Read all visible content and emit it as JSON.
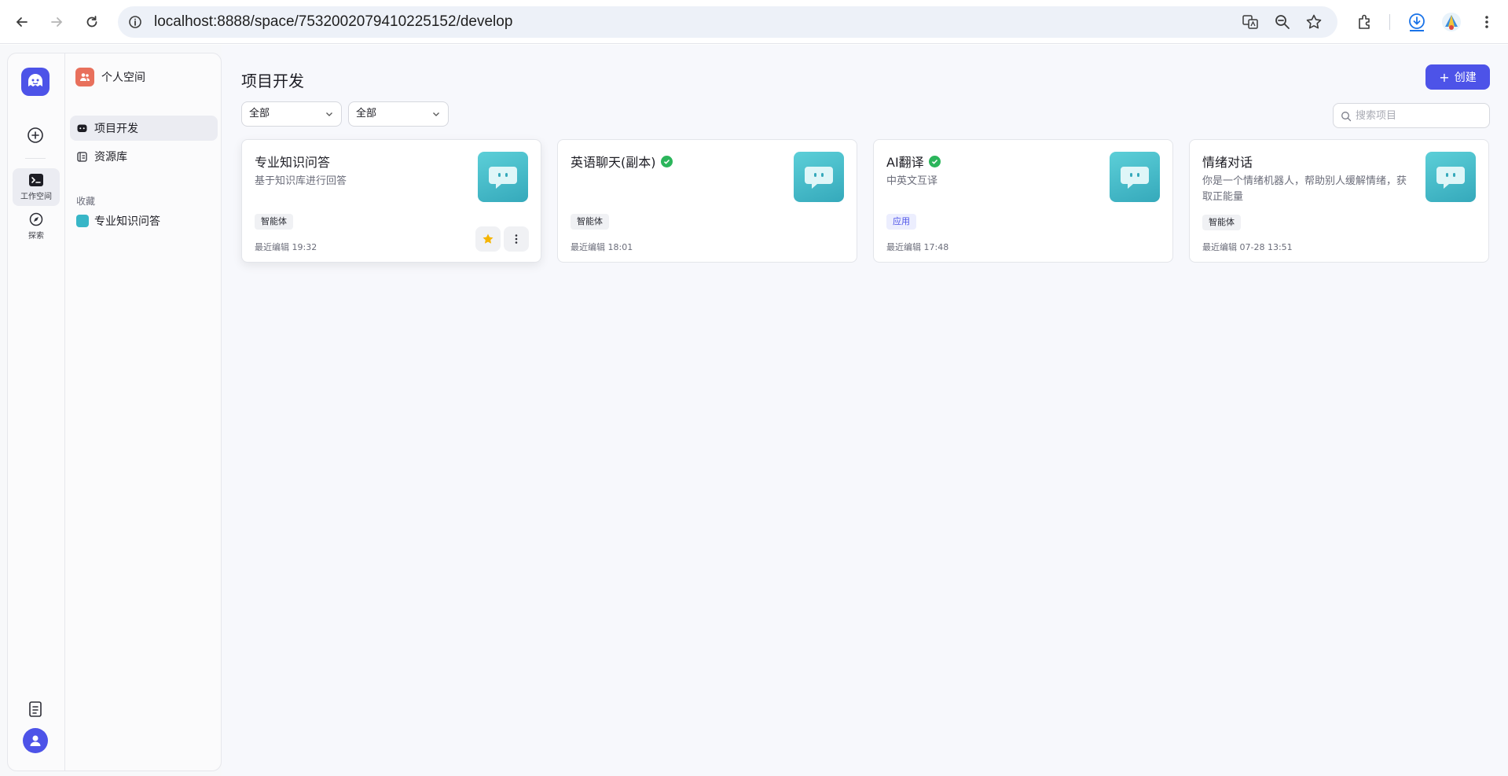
{
  "browser": {
    "url": "localhost:8888/space/7532002079410225152/develop",
    "icons": [
      "back-arrow-icon",
      "forward-arrow-icon",
      "reload-icon",
      "site-info-icon",
      "translate-icon",
      "zoom-icon",
      "bookmark-star-icon",
      "extensions-icon",
      "download-icon",
      "profile-icon",
      "kebab-menu-icon"
    ]
  },
  "rail": {
    "workspace_label": "工作空间",
    "explore_label": "探索"
  },
  "panel": {
    "space_name": "个人空间",
    "nav": [
      {
        "label": "项目开发"
      },
      {
        "label": "资源库"
      }
    ],
    "favorites_title": "收藏",
    "favorites": [
      {
        "label": "专业知识问答"
      }
    ]
  },
  "main": {
    "title": "项目开发",
    "create_label": "创建",
    "filter_type": "全部",
    "filter_owner": "全部",
    "search_placeholder": "搜索项目"
  },
  "cards": [
    {
      "title": "专业知识问答",
      "published": false,
      "desc": "基于知识库进行回答",
      "tag": "智能体",
      "time": "最近编辑 19:32"
    },
    {
      "title": "英语聊天(副本)",
      "published": true,
      "desc": "",
      "tag": "智能体",
      "time": "最近编辑 18:01"
    },
    {
      "title": "AI翻译",
      "published": true,
      "desc": "中英文互译",
      "tag": "应用",
      "time": "最近编辑 17:48"
    },
    {
      "title": "情绪对话",
      "published": false,
      "desc": "你是一个情绪机器人，帮助别人缓解情绪，获取正能量",
      "tag": "智能体",
      "time": "最近编辑 07-28 13:51"
    }
  ],
  "colors": {
    "accent": "#4d53e8",
    "published": "#2bb55b",
    "thumb": "#45bdc9",
    "favorite_star": "#f5b400"
  }
}
